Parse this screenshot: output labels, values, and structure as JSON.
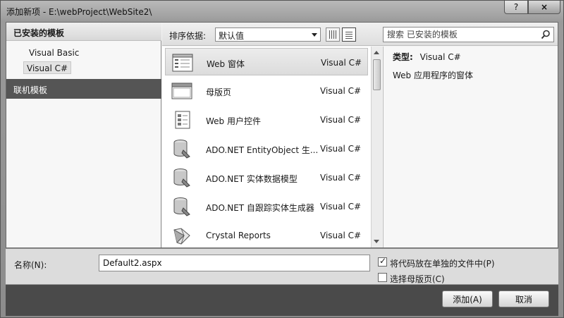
{
  "window": {
    "title": "添加新项 - E:\\webProject\\WebSite2\\",
    "help_label": "?",
    "close_label": "×"
  },
  "left": {
    "header": "已安装的模板",
    "items": [
      {
        "label": "Visual Basic"
      },
      {
        "label": "Visual C#"
      }
    ],
    "online_label": "联机模板"
  },
  "toolbar": {
    "sort_label": "排序依据:",
    "sort_value": "默认值",
    "search_placeholder": "搜索 已安装的模板"
  },
  "templates": [
    {
      "name": "Web 窗体",
      "language": "Visual C#",
      "icon": "webform-icon"
    },
    {
      "name": "母版页",
      "language": "Visual C#",
      "icon": "masterpage-icon"
    },
    {
      "name": "Web 用户控件",
      "language": "Visual C#",
      "icon": "usercontrol-icon"
    },
    {
      "name": "ADO.NET EntityObject 生...",
      "language": "Visual C#",
      "icon": "database-icon"
    },
    {
      "name": "ADO.NET 实体数据模型",
      "language": "Visual C#",
      "icon": "database-icon"
    },
    {
      "name": "ADO.NET 自跟踪实体生成器",
      "language": "Visual C#",
      "icon": "database-icon"
    },
    {
      "name": "Crystal Reports",
      "language": "Visual C#",
      "icon": "crystal-reports-icon"
    }
  ],
  "details": {
    "type_label": "类型:",
    "type_value": "Visual C#",
    "description": "Web 应用程序的窗体"
  },
  "bottom": {
    "name_label": "名称(N):",
    "name_value": "Default2.aspx",
    "checkbox_separate": "将代码放在单独的文件中(P)",
    "checkbox_master": "选择母版页(C)"
  },
  "buttons": {
    "add": "添加(A)",
    "cancel": "取消"
  }
}
